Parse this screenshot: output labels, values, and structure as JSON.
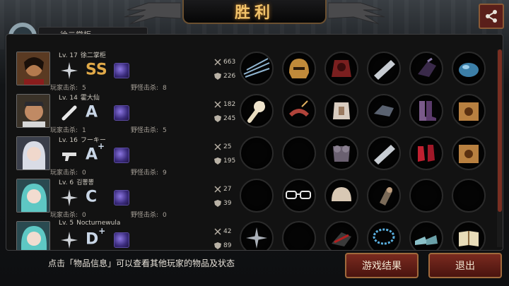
{
  "title": "胜利",
  "top_tab": "徐二掌柜",
  "players": [
    {
      "level": "Lv. 17",
      "name": "徐二掌柜",
      "grade": "SS",
      "grade_plus": "",
      "pk_label": "玩家击杀:",
      "pk": "5",
      "mk_label": "野怪击杀:",
      "mk": "8",
      "atk": "663",
      "def": "226",
      "grade_color": "#e0a948"
    },
    {
      "level": "Lv. 14",
      "name": "霍大仙",
      "grade": "A",
      "grade_plus": "",
      "pk_label": "玩家击杀:",
      "pk": "1",
      "mk_label": "野怪击杀:",
      "mk": "5",
      "atk": "182",
      "def": "245",
      "grade_color": "#c9d6e6"
    },
    {
      "level": "Lv. 16",
      "name": "フーキー",
      "grade": "A",
      "grade_plus": "+",
      "pk_label": "玩家击杀:",
      "pk": "0",
      "mk_label": "野怪击杀:",
      "mk": "9",
      "atk": "25",
      "def": "195",
      "grade_color": "#c9d6e6"
    },
    {
      "level": "Lv. 6",
      "name": "김뽕뽕",
      "grade": "C",
      "grade_plus": "",
      "pk_label": "玩家击杀:",
      "pk": "0",
      "mk_label": "野怪击杀:",
      "mk": "0",
      "atk": "27",
      "def": "39",
      "grade_color": "#c9d6e6"
    },
    {
      "level": "Lv. 5",
      "name": "Nocturnewula",
      "grade": "D",
      "grade_plus": "+",
      "pk_label": "",
      "pk": "",
      "mk_label": "",
      "mk": "",
      "atk": "42",
      "def": "89",
      "grade_color": "#c9d6e6"
    }
  ],
  "footer_hint": "点击「物品信息」可以查看其他玩家的物品及状态",
  "buttons": {
    "result": "游戏结果",
    "exit": "退出"
  },
  "colors": {
    "accent": "#f2c36a",
    "button": "#7a2a1f"
  }
}
